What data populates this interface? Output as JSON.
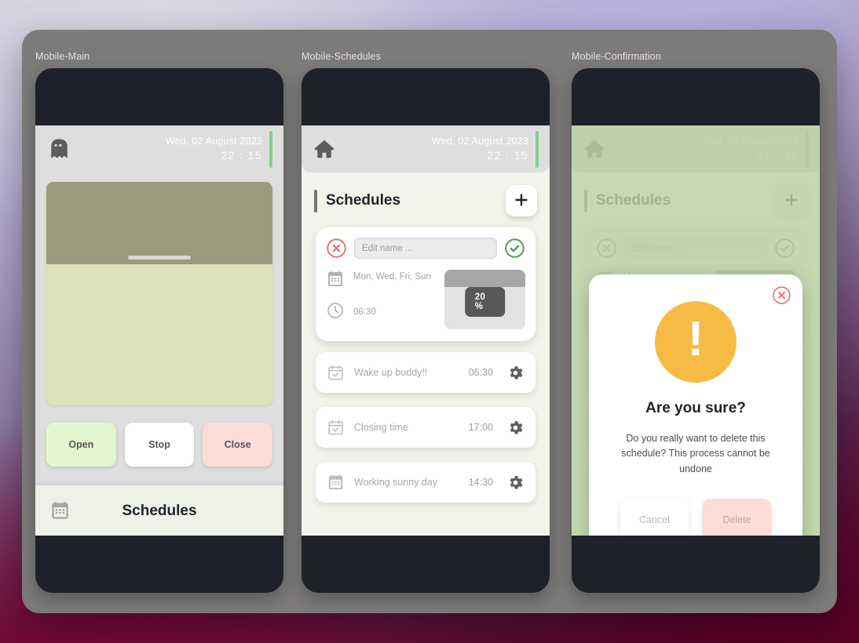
{
  "frame": {
    "panels": [
      {
        "label": "Mobile-Main"
      },
      {
        "label": "Mobile-Schedules"
      },
      {
        "label": "Mobile-Confirmation"
      }
    ]
  },
  "colors": {
    "accent_green": "#7fd18f",
    "open_button": "#e2f6cf",
    "close_button": "#fbdcd6",
    "warning": "#f7bb45",
    "danger": "#e8736f",
    "success": "#4c9a52",
    "overlay_green": "#bad2a2"
  },
  "status_bar": {
    "date": "Wed, 02 August 2023",
    "time": "22 : 15",
    "main_icon": "ghost-icon",
    "schedules_icon": "home-icon"
  },
  "main": {
    "door": {
      "shutter_percent": 20,
      "handle": "door-handle"
    },
    "buttons": [
      {
        "label": "Open",
        "name": "open-button"
      },
      {
        "label": "Stop",
        "name": "stop-button"
      },
      {
        "label": "Close",
        "name": "close-button"
      }
    ],
    "schedules_bar": {
      "label": "Schedules",
      "icon": "calendar-icon"
    }
  },
  "schedules": {
    "title": "Schedules",
    "add_button_icon": "plus-icon",
    "edit_card": {
      "cancel_icon": "circle-x-icon",
      "confirm_icon": "circle-check-icon",
      "name_value": "",
      "name_placeholder": "Edit name ...",
      "days_icon": "calendar-icon",
      "days": "Mon, Wed, Fri, Sun",
      "time_icon": "clock-icon",
      "time": "06:30",
      "preview": {
        "percent_label": "20 %",
        "percent": 20
      }
    },
    "items": [
      {
        "icon": "calendar-check-icon",
        "name": "Wake up buddy!!",
        "time": "06:30",
        "gear": "gear-icon"
      },
      {
        "icon": "calendar-check-icon",
        "name": "Closing time",
        "time": "17:00",
        "gear": "gear-icon"
      },
      {
        "icon": "calendar-icon",
        "name": "Working sunny day",
        "time": "14:30",
        "gear": "gear-icon"
      }
    ]
  },
  "confirmation": {
    "close_icon": "circle-x-icon",
    "warning_icon": "exclamation-icon",
    "warning_mark": "!",
    "title": "Are you sure?",
    "message": "Do you really want to delete this schedule? This process cannot be undone",
    "buttons": [
      {
        "label": "Cancel",
        "name": "cancel-button"
      },
      {
        "label": "Delete",
        "name": "delete-button"
      }
    ]
  }
}
